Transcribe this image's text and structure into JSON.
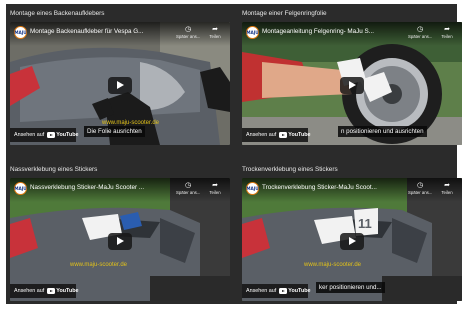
{
  "videos": [
    {
      "section_title": "Montage eines Backenaufklebers",
      "video_title": "Montage Backenaufkleber für Vespa G...",
      "channel_badge": "MAJU",
      "watch_later": "Später ans...",
      "share": "Teilen",
      "watch_on": "Ansehen auf",
      "youtube": "YouTube",
      "caption": "Die Folie ausrichten"
    },
    {
      "section_title": "Montage einer Felgenringfolie",
      "video_title": "Montageanleitung Felgenring- MaJu S...",
      "channel_badge": "MAJU",
      "watch_later": "Später ans...",
      "share": "Teilen",
      "watch_on": "Ansehen auf",
      "youtube": "YouTube",
      "caption": "n positionieren und ausrichten"
    },
    {
      "section_title": "Nassverklebung eines Stickers",
      "video_title": "Nassverklebung Sticker-MaJu Scooter ...",
      "channel_badge": "MAJU",
      "watch_later": "Später ans...",
      "share": "Teilen",
      "watch_on": "Ansehen auf",
      "youtube": "YouTube",
      "caption": ""
    },
    {
      "section_title": "Trockenverklebung eines Stickers",
      "video_title": "Trockenverklebung Sticker-MaJu Scoot...",
      "channel_badge": "MAJU",
      "watch_later": "Später ans...",
      "share": "Teilen",
      "watch_on": "Ansehen auf",
      "youtube": "YouTube",
      "caption": "ker positionieren und..."
    }
  ],
  "scene_text": {
    "website": "www.maju-scooter.de",
    "website_short": "www.maju-scooter.de",
    "number": "11"
  },
  "colors": {
    "background": "#2b2b2b",
    "scooter_grey": "#5a5f66",
    "taillight_red": "#c8323a",
    "glove_black": "#1b1b1b",
    "glove_white": "#f2f2f2",
    "lettering_yellow": "#e2c21a",
    "grass": "#4f7a3a",
    "youtube_red": "#ff0000"
  }
}
